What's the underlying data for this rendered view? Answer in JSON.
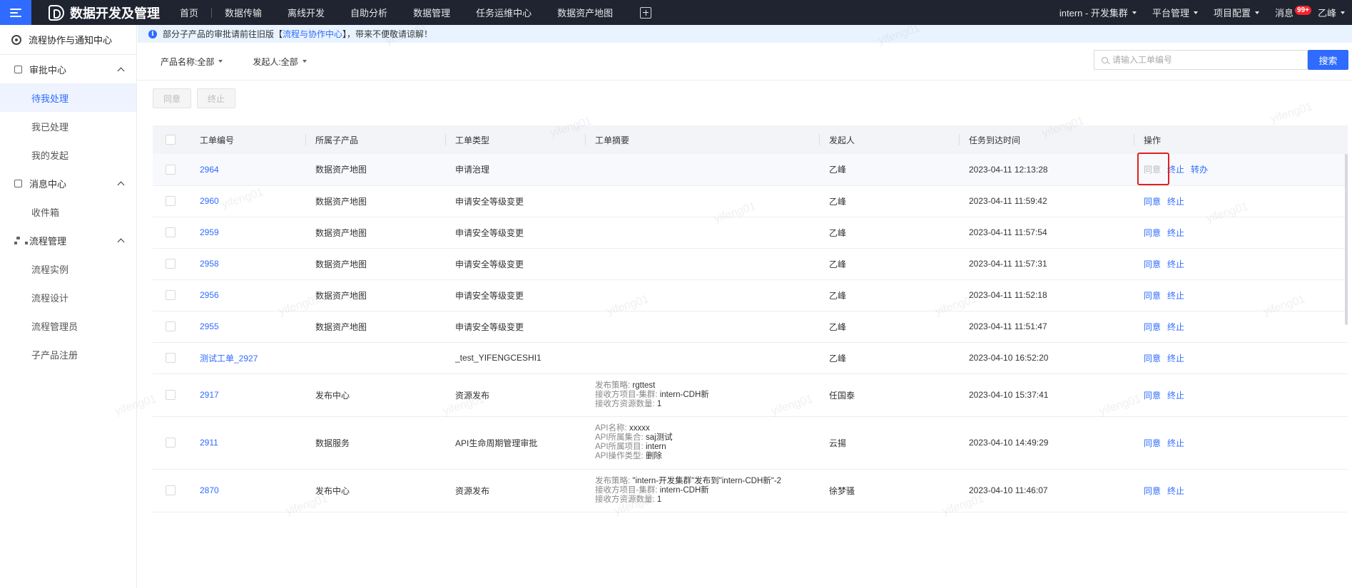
{
  "topbar": {
    "brand": "数据开发及管理",
    "nav": [
      "首页",
      "数据传输",
      "离线开发",
      "自助分析",
      "数据管理",
      "任务运维中心",
      "数据资产地图"
    ],
    "right": {
      "cluster": "intern - 开发集群",
      "platform": "平台管理",
      "project": "项目配置",
      "messages": "消息",
      "badge": "99+",
      "user": "乙峰"
    }
  },
  "sidebar": {
    "header": "流程协作与通知中心",
    "groups": [
      {
        "label": "审批中心",
        "items": [
          "待我处理",
          "我已处理",
          "我的发起"
        ]
      },
      {
        "label": "消息中心",
        "items": [
          "收件箱"
        ]
      },
      {
        "label": "流程管理",
        "items": [
          "流程实例",
          "流程设计",
          "流程管理员",
          "子产品注册"
        ]
      }
    ]
  },
  "notice": {
    "prefix": "部分子产品的审批请前往旧版【",
    "link": "流程与协作中心",
    "suffix": "】，带来不便敬请谅解！"
  },
  "filters": {
    "product": "产品名称:全部",
    "initiator": "发起人:全部",
    "search_placeholder": "请输入工单编号",
    "search_button": "搜索"
  },
  "actions": {
    "approve": "同意",
    "terminate": "终止"
  },
  "table": {
    "columns": [
      "工单编号",
      "所属子产品",
      "工单类型",
      "工单摘要",
      "发起人",
      "任务到达时间",
      "操作"
    ],
    "ops": {
      "approve": "同意",
      "terminate": "终止",
      "transfer": "转办"
    },
    "rows": [
      {
        "id": "2964",
        "product": "数据资产地图",
        "type": "申请治理",
        "summary": [],
        "initiator": "乙峰",
        "time": "2023-04-11 12:13:28"
      },
      {
        "id": "2960",
        "product": "数据资产地图",
        "type": "申请安全等级变更",
        "summary": [],
        "initiator": "乙峰",
        "time": "2023-04-11 11:59:42"
      },
      {
        "id": "2959",
        "product": "数据资产地图",
        "type": "申请安全等级变更",
        "summary": [],
        "initiator": "乙峰",
        "time": "2023-04-11 11:57:54"
      },
      {
        "id": "2958",
        "product": "数据资产地图",
        "type": "申请安全等级变更",
        "summary": [],
        "initiator": "乙峰",
        "time": "2023-04-11 11:57:31"
      },
      {
        "id": "2956",
        "product": "数据资产地图",
        "type": "申请安全等级变更",
        "summary": [],
        "initiator": "乙峰",
        "time": "2023-04-11 11:52:18"
      },
      {
        "id": "2955",
        "product": "数据资产地图",
        "type": "申请安全等级变更",
        "summary": [],
        "initiator": "乙峰",
        "time": "2023-04-11 11:51:47"
      },
      {
        "id": "测试工单_2927",
        "product": "",
        "type": "_test_YIFENGCESHI1",
        "summary": [],
        "initiator": "乙峰",
        "time": "2023-04-10 16:52:20"
      },
      {
        "id": "2917",
        "product": "发布中心",
        "type": "资源发布",
        "summary": [
          [
            "发布策略:",
            "rgttest"
          ],
          [
            "接收方项目-集群:",
            "intern-CDH新"
          ],
          [
            "接收方资源数量:",
            "1"
          ]
        ],
        "initiator": "任国泰",
        "time": "2023-04-10 15:37:41"
      },
      {
        "id": "2911",
        "product": "数据服务",
        "type": "API生命周期管理审批",
        "summary": [
          [
            "API名称:",
            "xxxxx"
          ],
          [
            "API所属集合:",
            "saj测试"
          ],
          [
            "API所属项目:",
            "intern"
          ],
          [
            "API操作类型:",
            "删除"
          ]
        ],
        "initiator": "云揚",
        "time": "2023-04-10 14:49:29"
      },
      {
        "id": "2870",
        "product": "发布中心",
        "type": "资源发布",
        "summary": [
          [
            "发布策略:",
            "\"intern-开发集群\"发布到\"intern-CDH新\"-2"
          ],
          [
            "接收方项目-集群:",
            "intern-CDH新"
          ],
          [
            "接收方资源数量:",
            "1"
          ]
        ],
        "initiator": "徐梦骚",
        "time": "2023-04-10 11:46:07"
      }
    ]
  },
  "watermark": "yifeng01",
  "colors": {
    "accent": "#2f6bff",
    "topbar": "#1f2430",
    "highlight": "#e02020"
  }
}
